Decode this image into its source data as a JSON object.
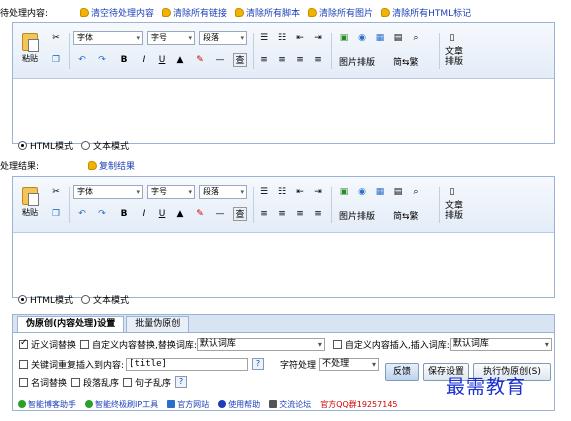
{
  "top": {
    "label": "待处理内容:",
    "links": [
      "清空待处理内容",
      "清除所有链接",
      "清除所有脚本",
      "清除所有图片",
      "清除所有HTML标记"
    ]
  },
  "toolbar": {
    "paste": "粘贴",
    "font": "字体",
    "size": "字号",
    "para": "段落",
    "bold": "B",
    "italic": "I",
    "underline": "U",
    "find": "查",
    "img_layout": "图片排版",
    "trad": "简⇆繁",
    "typeset": "文章排版"
  },
  "modes": {
    "html": "HTML模式",
    "text": "文本模式"
  },
  "result": {
    "label": "处理结果:",
    "copy": "复制结果"
  },
  "panel": {
    "tabs": [
      "伪原创(内容处理)设置",
      "批量伪原创"
    ],
    "syn_label": "近义词替换",
    "custom_replace": "自定义内容替换,替换词库:",
    "lib1": "默认词库",
    "custom_insert": "自定义内容插入,插入词库:",
    "lib2": "默认词库",
    "repeat_label": "关键词重复插入到内容:",
    "repeat_value": "[title]",
    "char_label": "字符处理",
    "char_value": "不处理",
    "name_label": "名词替换",
    "para_label": "段落乱序",
    "sent_label": "句子乱序",
    "help": "?",
    "btn_reverse": "反馈",
    "btn_save": "保存设置",
    "btn_exec": "执行伪原创(S)"
  },
  "footer": {
    "items": [
      "智能博客助手",
      "智能终极刷IP工具",
      "官方网站",
      "使用帮助",
      "交流论坛"
    ],
    "qq": "官方QQ群19257145"
  },
  "watermark": "最需教育",
  "colors": {
    "link": "#1a3fb8",
    "border": "#9bb4d6",
    "toolbar": "#e3ecf7",
    "qq": "#d00000"
  }
}
